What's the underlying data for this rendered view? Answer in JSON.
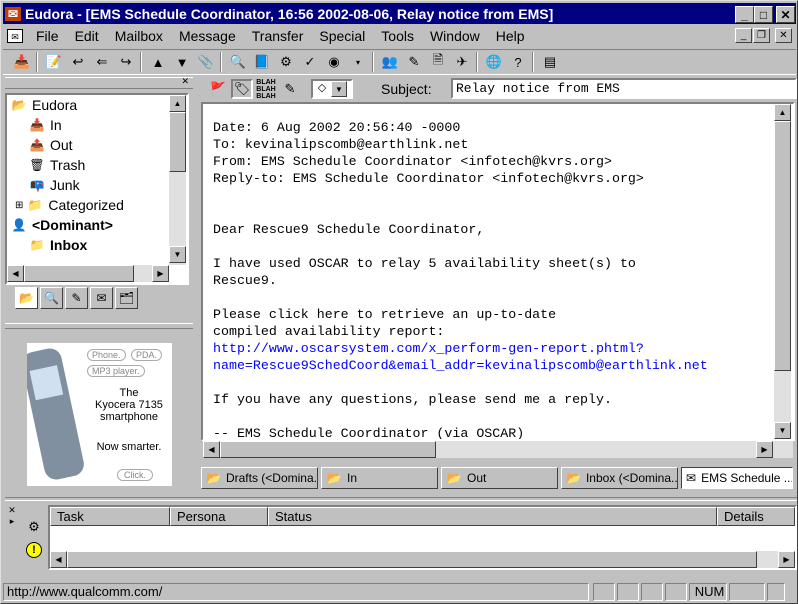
{
  "app": {
    "title": "Eudora - [EMS Schedule Coordinator, 16:56 2002-08-06, Relay notice from EMS]"
  },
  "menu": [
    "File",
    "Edit",
    "Mailbox",
    "Message",
    "Transfer",
    "Special",
    "Tools",
    "Window",
    "Help"
  ],
  "mailboxes": [
    {
      "label": "Eudora",
      "bold": false,
      "indent": 0,
      "icon": "eudora-icon"
    },
    {
      "label": "In",
      "bold": false,
      "indent": 1,
      "icon": "inbox-icon"
    },
    {
      "label": "Out",
      "bold": false,
      "indent": 1,
      "icon": "outbox-icon"
    },
    {
      "label": "Trash",
      "bold": false,
      "indent": 1,
      "icon": "trash-icon"
    },
    {
      "label": "Junk",
      "bold": false,
      "indent": 1,
      "icon": "junk-icon"
    },
    {
      "label": "Categorized",
      "bold": false,
      "indent": 1,
      "icon": "folder-icon"
    },
    {
      "label": "<Dominant>",
      "bold": true,
      "indent": 0,
      "icon": "dominant-icon"
    },
    {
      "label": "Inbox",
      "bold": true,
      "indent": 1,
      "icon": "folder-icon"
    }
  ],
  "ad": {
    "tags": [
      "Phone.",
      "PDA.",
      "MP3 player."
    ],
    "line1": "The",
    "line2": "Kyocera 7135",
    "line3": "smartphone",
    "line4": "Now smarter.",
    "cta": "Click."
  },
  "message": {
    "subject_label": "Subject:",
    "subject": "Relay notice from EMS",
    "date": "Date: 6 Aug 2002 20:56:40 -0000",
    "to": "To: kevinalipscomb@earthlink.net",
    "from": "From: EMS Schedule Coordinator <infotech@kvrs.org>",
    "reply_to": "Reply-to: EMS Schedule Coordinator <infotech@kvrs.org>",
    "greeting": "Dear Rescue9 Schedule Coordinator,",
    "p1a": "I have used OSCAR to relay 5 availability sheet(s) to",
    "p1b": "Rescue9.",
    "p2a": "Please click here to retrieve an up-to-date",
    "p2b": "compiled availability report:",
    "url1": "http://www.oscarsystem.com/x_perform-gen-report.phtml?",
    "url2": "name=Rescue9SchedCoord&email_addr=kevinalipscomb@earthlink.net",
    "p3": "If you have any questions, please send me a reply.",
    "sig": "-- EMS Schedule Coordinator (via OSCAR)"
  },
  "window_tabs": [
    "Drafts (<Domina...",
    "In",
    "Out",
    "Inbox (<Domina...",
    "EMS Schedule ..."
  ],
  "task_columns": [
    "Task",
    "Persona",
    "Status",
    "Details"
  ],
  "status": {
    "url": "http://www.qualcomm.com/",
    "num": "NUM"
  }
}
